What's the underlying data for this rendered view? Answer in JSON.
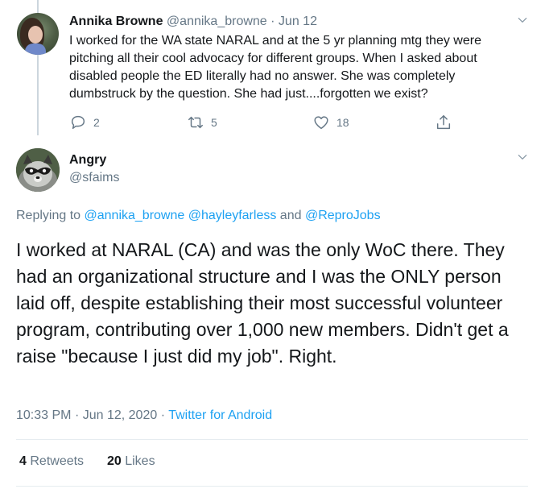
{
  "parent_tweet": {
    "name": "Annika Browne",
    "handle": "@annika_browne",
    "separator": "·",
    "date": "Jun 12",
    "text": "I worked for the WA state NARAL and at the 5 yr planning mtg they were pitching all their cool advocacy for different groups. When I asked about disabled people the ED literally had no answer. She was completely dumbstruck by the question. She had just....forgotten we exist?",
    "reply_count": "2",
    "retweet_count": "5",
    "like_count": "18"
  },
  "reply_tweet": {
    "name": "Angry",
    "handle": "@sfaims",
    "replying_prefix": "Replying to",
    "replying_user1": "@annika_browne",
    "replying_user2": "@hayleyfarless",
    "replying_and": "and",
    "replying_user3": "@ReproJobs",
    "text": "I worked at NARAL (CA) and was the only WoC there. They had an organizational structure and I was the ONLY person laid off, despite establishing their most successful volunteer program, contributing over 1,000 new members. Didn't get a raise \"because I just did my job\". Right.",
    "time": "10:33 PM",
    "meta_sep1": "·",
    "date": "Jun 12, 2020",
    "meta_sep2": "·",
    "source": "Twitter for Android",
    "retweets_count": "4",
    "retweets_label": "Retweets",
    "likes_count": "20",
    "likes_label": "Likes"
  },
  "icons": {
    "reply": "reply-icon",
    "retweet": "retweet-icon",
    "like": "heart-icon",
    "share": "share-icon",
    "more": "chevron-down-icon"
  },
  "colors": {
    "link": "#1da1f2",
    "secondary": "#657786",
    "text": "#14171a",
    "thread_line": "#ccd6dd"
  }
}
